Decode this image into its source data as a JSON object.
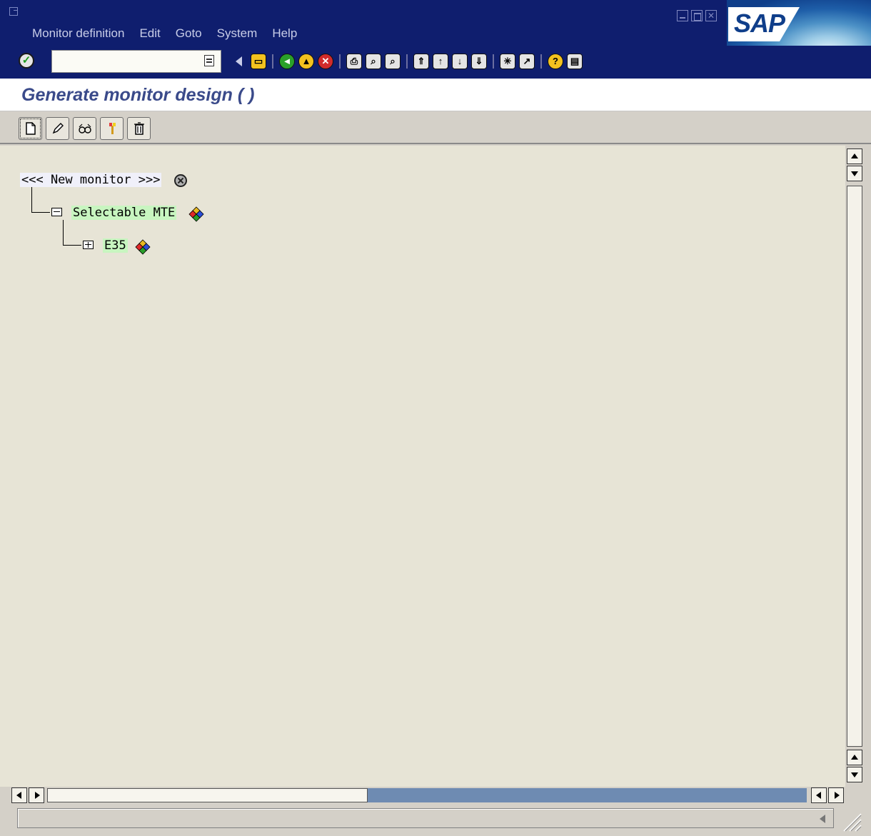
{
  "menubar": {
    "items": [
      {
        "label": "Monitor definition",
        "mnemonic": "M"
      },
      {
        "label": "Edit",
        "mnemonic": "E"
      },
      {
        "label": "Goto",
        "mnemonic": "G"
      },
      {
        "label": "System",
        "mnemonic": ""
      },
      {
        "label": "Help",
        "mnemonic": "H"
      }
    ]
  },
  "logo": {
    "text": "SAP"
  },
  "command_field": {
    "value": ""
  },
  "title": "Generate monitor design ( )",
  "tree": {
    "root": {
      "label": "<<< New monitor >>>"
    },
    "child": {
      "label": "Selectable MTE"
    },
    "grandchild": {
      "label": "E35"
    }
  },
  "colors": {
    "header_bg": "#0f1e6e",
    "title_text": "#3a4a8a",
    "content_bg": "#e7e4d6",
    "node_highlight": "#c8f5c0"
  },
  "icons": {
    "standard_toolbar": [
      "enter-icon",
      "back-icon",
      "save-icon",
      "back-green-icon",
      "exit-icon",
      "cancel-icon",
      "print-icon",
      "find-icon",
      "find-next-icon",
      "first-page-icon",
      "previous-page-icon",
      "next-page-icon",
      "last-page-icon",
      "create-session-icon",
      "shortcut-icon",
      "help-icon",
      "layout-menu-icon"
    ],
    "application_toolbar": [
      "create-icon",
      "change-icon",
      "display-icon",
      "transport-icon",
      "delete-icon"
    ]
  }
}
